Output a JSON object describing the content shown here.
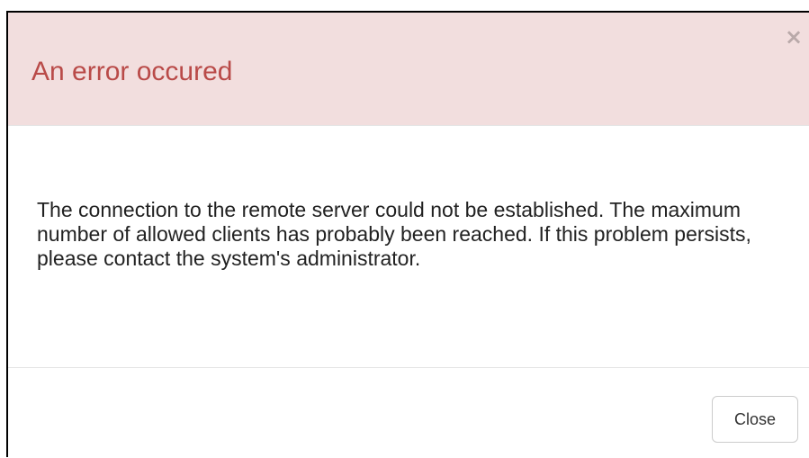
{
  "dialog": {
    "title": "An error occured",
    "close_icon": "close-icon",
    "close_symbol": "×",
    "message": "The connection to the remote server could not be established. The maximum number of allowed clients has probably been reached. If this problem persists, please contact the system's administrator.",
    "close_button_label": "Close"
  },
  "colors": {
    "header_background": "#f2dede",
    "title_color": "#b94a48",
    "text_color": "#222222",
    "border": "#cccccc"
  }
}
